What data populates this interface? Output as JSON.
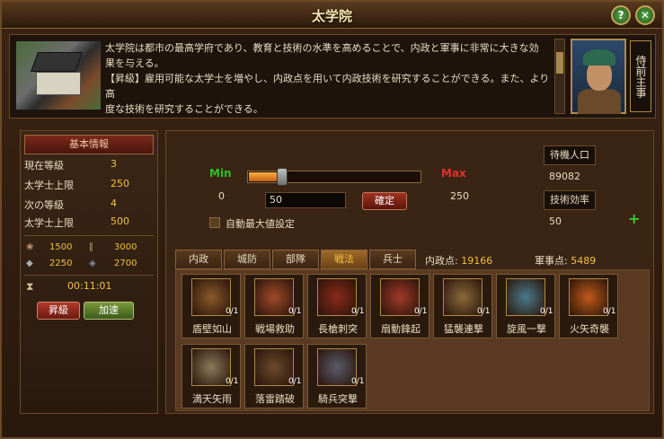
{
  "window": {
    "title": "太学院"
  },
  "description": {
    "line1": "太学院は都市の最高学府であり、教育と技術の水準を高めることで、内政と軍事に非常に大きな効",
    "line2": "果を与える。",
    "line3": "【昇級】雇用可能な太学士を増やし、内政点を用いて内政技術を研究することができる。また、より高",
    "line4": "度な技術を研究することができる。",
    "official_title": "侍前主事"
  },
  "info": {
    "header": "基本情報",
    "rows": [
      {
        "label": "現在等級",
        "value": "3"
      },
      {
        "label": "太学士上限",
        "value": "250"
      },
      {
        "label": "次の等級",
        "value": "4"
      },
      {
        "label": "太学士上限",
        "value": "500"
      }
    ],
    "resources": [
      {
        "icon": "food-icon",
        "value": "1500"
      },
      {
        "icon": "wood-icon",
        "value": "3000"
      },
      {
        "icon": "stone-icon",
        "value": "2250"
      },
      {
        "icon": "iron-icon",
        "value": "2700"
      }
    ],
    "timer": "00:11:01",
    "upgrade_label": "昇級",
    "speedup_label": "加速"
  },
  "allocation": {
    "min_label": "Min",
    "max_label": "Max",
    "min_value": "0",
    "max_value": "250",
    "amount": "50",
    "slider_fraction": 0.2,
    "confirm_label": "確定",
    "auto_label": "自動最大値設定",
    "waiting_label": "待機人口",
    "waiting_value": "89082",
    "efficiency_label": "技術効率",
    "efficiency_value": "50"
  },
  "tabs": [
    {
      "label": "内政",
      "active": false
    },
    {
      "label": "城防",
      "active": false
    },
    {
      "label": "部隊",
      "active": false
    },
    {
      "label": "戦法",
      "active": true
    },
    {
      "label": "兵士",
      "active": false
    }
  ],
  "points": {
    "domestic_label": "内政点:",
    "domestic_value": "19166",
    "military_label": "軍事点:",
    "military_value": "5489"
  },
  "techs": [
    {
      "name": "盾壁如山",
      "level": "0/1"
    },
    {
      "name": "戦場救助",
      "level": "0/1"
    },
    {
      "name": "長槍刺突",
      "level": "0/1"
    },
    {
      "name": "扇動鋒起",
      "level": "0/1"
    },
    {
      "name": "猛襲連撃",
      "level": "0/1"
    },
    {
      "name": "旋風一撃",
      "level": "0/1"
    },
    {
      "name": "火矢奇襲",
      "level": "0/1"
    },
    {
      "name": "満天矢雨",
      "level": "0/1"
    },
    {
      "name": "落雷踏破",
      "level": "0/1"
    },
    {
      "name": "騎兵突撃",
      "level": "0/1"
    }
  ]
}
